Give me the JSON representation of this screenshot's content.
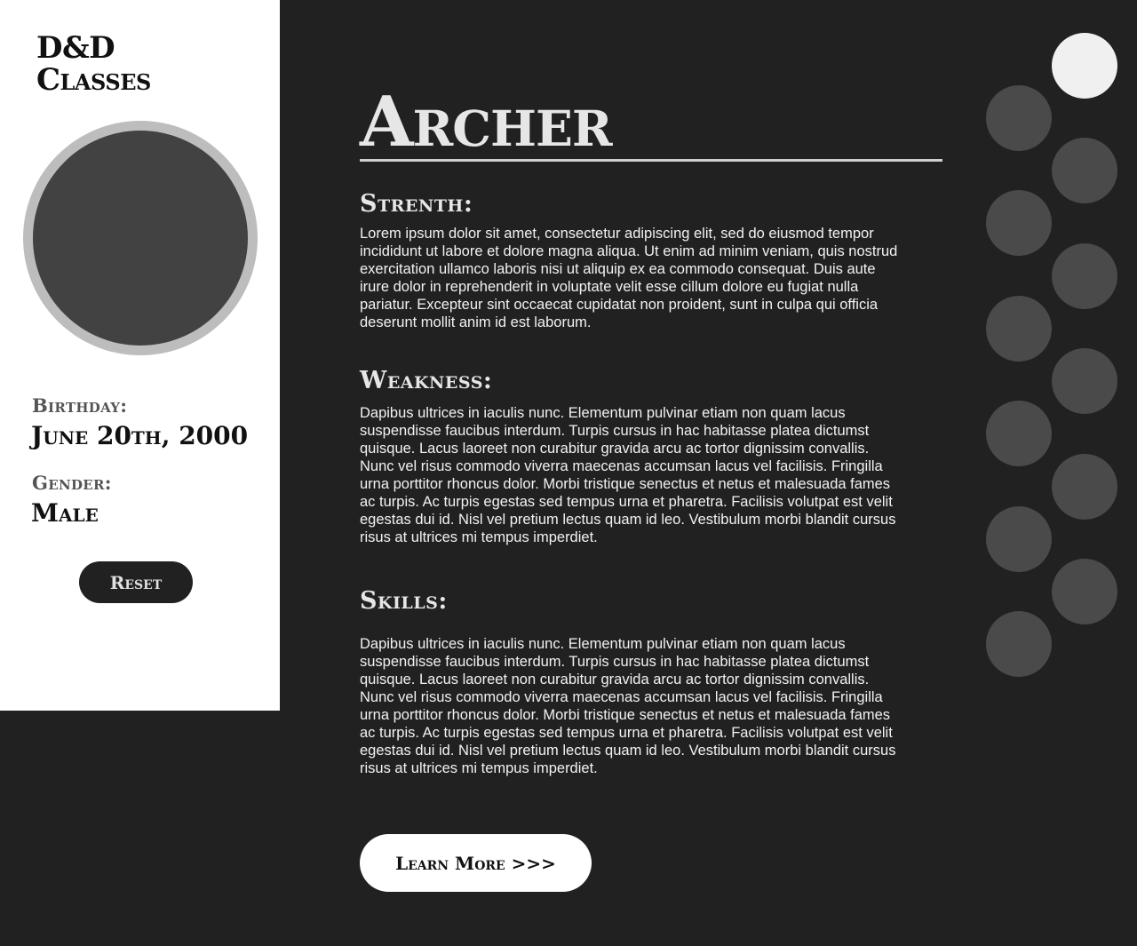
{
  "sidebar": {
    "logo_line1": "D&D",
    "logo_line2": "Classes",
    "birthday_label": "Birthday:",
    "birthday_value": "June 20th, 2000",
    "gender_label": "Gender:",
    "gender_value": "Male",
    "reset_label": "Reset"
  },
  "main": {
    "class_title": "Archer",
    "sections": [
      {
        "heading": "Strenth:",
        "text": "Lorem ipsum dolor sit amet, consectetur adipiscing elit, sed do eiusmod tempor incididunt ut labore et dolore magna aliqua. Ut enim ad minim veniam, quis nostrud exercitation ullamco laboris nisi ut aliquip ex ea commodo consequat. Duis aute irure dolor in reprehenderit in voluptate velit esse cillum dolore eu fugiat nulla pariatur. Excepteur sint occaecat cupidatat non proident, sunt in culpa qui officia deserunt mollit anim id est laborum."
      },
      {
        "heading": "Weakness:",
        "text": "Dapibus ultrices in iaculis nunc. Elementum pulvinar etiam non quam lacus suspendisse faucibus interdum. Turpis cursus in hac habitasse platea dictumst quisque. Lacus laoreet non curabitur gravida arcu ac tortor dignissim convallis. Nunc vel risus commodo viverra maecenas accumsan lacus vel facilisis. Fringilla urna porttitor rhoncus dolor. Morbi tristique senectus et netus et malesuada fames ac turpis. Ac turpis egestas sed tempus urna et pharetra. Facilisis volutpat est velit egestas dui id. Nisl vel pretium lectus quam id leo. Vestibulum morbi blandit cursus risus at ultrices mi tempus imperdiet."
      },
      {
        "heading": "Skills:",
        "text": "Dapibus ultrices in iaculis nunc. Elementum pulvinar etiam non quam lacus suspendisse faucibus interdum. Turpis cursus in hac habitasse platea dictumst quisque. Lacus laoreet non curabitur gravida arcu ac tortor dignissim convallis. Nunc vel risus commodo viverra maecenas accumsan lacus vel facilisis. Fringilla urna porttitor rhoncus dolor. Morbi tristique senectus et netus et malesuada fames ac turpis. Ac turpis egestas sed tempus urna et pharetra. Facilisis volutpat est velit egestas dui id. Nisl vel pretium lectus quam id leo. Vestibulum morbi blandit cursus risus at ultrices mi tempus imperdiet."
      }
    ],
    "learn_more_label": "Learn More >>>"
  },
  "colors": {
    "background": "#212121",
    "sidebar": "#ffffff",
    "dot_inactive": "#4a4a4a",
    "dot_active": "#f0f0f0"
  }
}
